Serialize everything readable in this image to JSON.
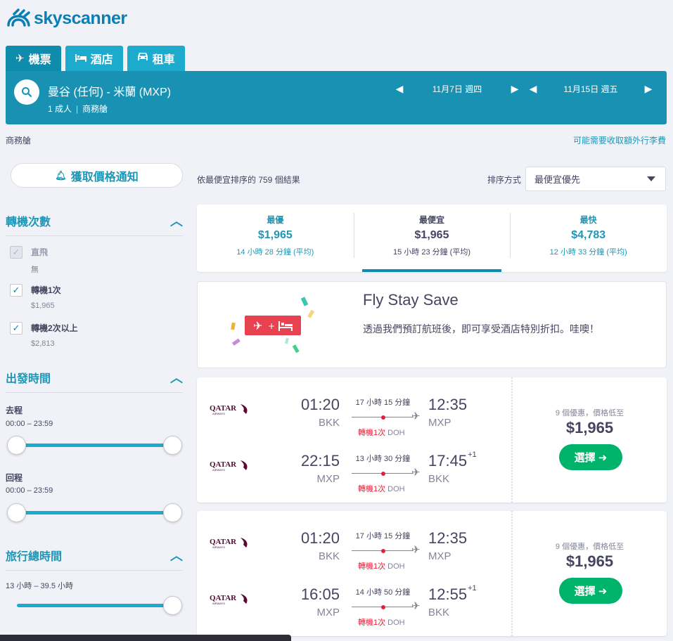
{
  "brand": {
    "logo_text": "skyscanner"
  },
  "tabs": [
    {
      "label": "機票",
      "icon": "plane-icon",
      "active": true
    },
    {
      "label": "酒店",
      "icon": "bed-icon",
      "active": false
    },
    {
      "label": "租車",
      "icon": "car-icon",
      "active": false
    }
  ],
  "search": {
    "route": "曼谷 (任何) - 米蘭 (MXP)",
    "passengers": "1 成人",
    "cabin": "商務艙",
    "depart_date": "11月7日 週四",
    "return_date": "11月15日 週五"
  },
  "cabin_line": "商務艙",
  "baggage_link": "可能需要收取額外行李費",
  "sidebar": {
    "alert_button": "獲取價格通知",
    "stops": {
      "title": "轉機次數",
      "options": [
        {
          "label": "直飛",
          "sub": "無",
          "checked": true,
          "disabled": true
        },
        {
          "label": "轉機1次",
          "sub": "$1,965",
          "checked": true,
          "disabled": false
        },
        {
          "label": "轉機2次以上",
          "sub": "$2,813",
          "checked": true,
          "disabled": false
        }
      ]
    },
    "times": {
      "title": "出發時間",
      "outbound_label": "去程",
      "outbound_range": "00:00 – 23:59",
      "return_label": "回程",
      "return_range": "00:00 – 23:59"
    },
    "duration": {
      "title": "旅行總時間",
      "range": "13 小時 – 39.5 小時"
    }
  },
  "results": {
    "count_text": "依最便宜排序的 759 個結果",
    "sort_label": "排序方式",
    "sort_value": "最便宜優先"
  },
  "summary_tabs": [
    {
      "title": "最優",
      "price": "$1,965",
      "duration": "14 小時 28 分鐘 (平均)",
      "active": false
    },
    {
      "title": "最便宜",
      "price": "$1,965",
      "duration": "15 小時 23 分鐘 (平均)",
      "active": true
    },
    {
      "title": "最快",
      "price": "$4,783",
      "duration": "12 小時 33 分鐘 (平均)",
      "active": false
    }
  ],
  "promo": {
    "title": "Fly Stay Save",
    "text": "透過我們預訂航班後，即可享受酒店特別折扣。哇噢！"
  },
  "flights": [
    {
      "legs": [
        {
          "airline": "QATAR",
          "dep_time": "01:20",
          "dep_ap": "BKK",
          "duration": "17 小時 15 分鐘",
          "stops": "轉機1次",
          "via": "DOH",
          "arr_time": "12:35",
          "arr_ap": "MXP",
          "day_offset": ""
        },
        {
          "airline": "QATAR",
          "dep_time": "22:15",
          "dep_ap": "MXP",
          "duration": "13 小時 30 分鐘",
          "stops": "轉機1次",
          "via": "DOH",
          "arr_time": "17:45",
          "arr_ap": "BKK",
          "day_offset": "+1"
        }
      ],
      "deals": "9 個優惠，價格低至",
      "price": "$1,965",
      "select_label": "選擇 ➜"
    },
    {
      "legs": [
        {
          "airline": "QATAR",
          "dep_time": "01:20",
          "dep_ap": "BKK",
          "duration": "17 小時 15 分鐘",
          "stops": "轉機1次",
          "via": "DOH",
          "arr_time": "12:35",
          "arr_ap": "MXP",
          "day_offset": ""
        },
        {
          "airline": "QATAR",
          "dep_time": "16:05",
          "dep_ap": "MXP",
          "duration": "14 小時 50 分鐘",
          "stops": "轉機1次",
          "via": "DOH",
          "arr_time": "12:55",
          "arr_ap": "BKK",
          "day_offset": "+1"
        }
      ],
      "deals": "9 個優惠，價格低至",
      "price": "$1,965",
      "select_label": "選擇 ➜"
    }
  ],
  "colors": {
    "brand": "#0a7fb5",
    "bar": "#1891b3",
    "tab": "#1dabcd",
    "select": "#00b36b",
    "stops_red": "#e3213b"
  }
}
